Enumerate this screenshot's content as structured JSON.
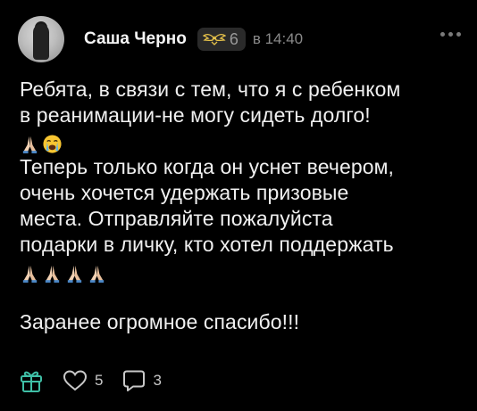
{
  "author": {
    "name": "Саша Черно",
    "badge_level": "6",
    "time": "в 14:40"
  },
  "post": {
    "lines": [
      "Ребята, в связи с тем, что я с ребенком",
      "в реанимации-не могу сидеть долго!",
      "Теперь только когда он уснет вечером,",
      "очень хочется удержать призовые",
      "места. Отправляйте пожалуйста",
      "подарки в личку, кто хотел поддержать",
      "Заранее огромное спасибо!!!"
    ],
    "emoji_line_1": [
      "folded-hands",
      "crying-face"
    ],
    "emoji_line_2": [
      "folded-hands",
      "folded-hands",
      "folded-hands",
      "folded-hands"
    ]
  },
  "actions": {
    "likes": "5",
    "comments": "3"
  },
  "colors": {
    "background": "#000000",
    "accent_gift": "#3fbfa6",
    "muted": "#8a8a8a"
  }
}
